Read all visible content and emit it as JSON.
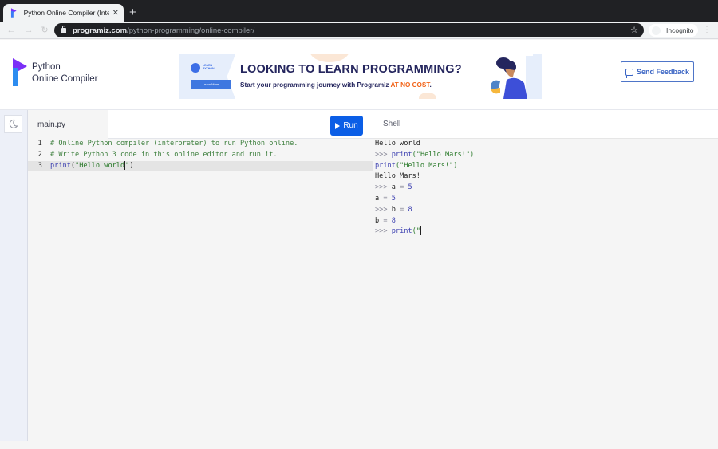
{
  "browser": {
    "tab_title": "Python Online Compiler (Interp",
    "url_host": "programiz.com",
    "url_path": "/python-programming/online-compiler/",
    "profile_label": "Incognito"
  },
  "header": {
    "brand_line1": "Python",
    "brand_line2": "Online Compiler",
    "banner": {
      "logo_text": "LEARN PYTHON",
      "button_label": "Learn More",
      "headline": "LOOKING TO LEARN PROGRAMMING?",
      "subline": "Start your programming journey with Programiz ",
      "subline_highlight": "AT NO COST",
      "subline_end": "."
    },
    "feedback_label": "Send Feedback",
    "colors": {
      "brand_blue": "#0b5ee6",
      "brand_purple": "#7b2ff7",
      "highlight_orange": "#f26419"
    }
  },
  "editor": {
    "file_tab": "main.py",
    "run_label": "Run",
    "lines": [
      {
        "num": "1",
        "comment": "# Online Python compiler (interpreter) to run Python online."
      },
      {
        "num": "2",
        "comment": "# Write Python 3 code in this online editor and run it."
      },
      {
        "num": "3",
        "fn": "print",
        "open": "(",
        "str1": "\"Hello world",
        "str2": "\"",
        "close": ")"
      }
    ]
  },
  "shell": {
    "title": "Shell",
    "prompt": ">>>",
    "lines": {
      "l1": "Hello world",
      "l2_fn": "print",
      "l2_str": "(\"Hello Mars!\")",
      "l3_fn": "print",
      "l3_str": "(\"Hello Mars!\")",
      "l4": "Hello Mars!",
      "l5_var": "a",
      "l5_op": "=",
      "l5_val": "5",
      "l6_var": "a",
      "l6_op": "=",
      "l6_val": "5",
      "l7_var": "b",
      "l7_op": "=",
      "l7_val": "8",
      "l8_var": "b",
      "l8_op": "=",
      "l8_val": "8",
      "l9_fn": "print",
      "l9_rest": "(\""
    }
  }
}
